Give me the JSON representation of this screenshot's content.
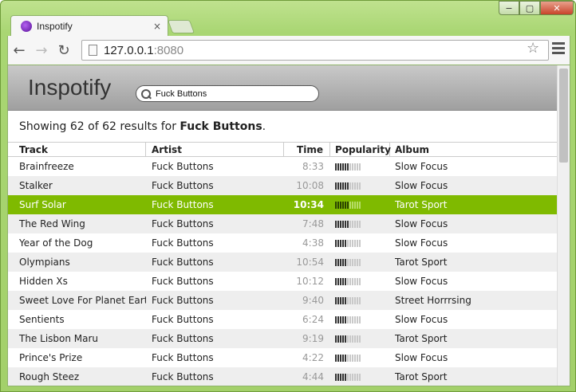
{
  "browser": {
    "tab_title": "Inspotify",
    "tab_close": "×",
    "url_host": "127.0.0.1",
    "url_port": ":8080",
    "back": "←",
    "forward": "→",
    "reload": "↻",
    "star": "☆",
    "min": "−",
    "max": "▢",
    "close": "✕"
  },
  "app": {
    "title": "Inspotify",
    "search_value": "Fuck Buttons"
  },
  "summary": {
    "prefix": "Showing 62 of 62 results for ",
    "query": "Fuck Buttons",
    "suffix": "."
  },
  "columns": {
    "track": "Track",
    "artist": "Artist",
    "time": "Time",
    "popularity": "Popularity",
    "album": "Album"
  },
  "rows": [
    {
      "track": "Brainfreeze",
      "artist": "Fuck Buttons",
      "time": "8:33",
      "pop": 6,
      "album": "Slow Focus"
    },
    {
      "track": "Stalker",
      "artist": "Fuck Buttons",
      "time": "10:08",
      "pop": 6,
      "album": "Slow Focus"
    },
    {
      "track": "Surf Solar",
      "artist": "Fuck Buttons",
      "time": "10:34",
      "pop": 6,
      "album": "Tarot Sport",
      "selected": true
    },
    {
      "track": "The Red Wing",
      "artist": "Fuck Buttons",
      "time": "7:48",
      "pop": 6,
      "album": "Slow Focus"
    },
    {
      "track": "Year of the Dog",
      "artist": "Fuck Buttons",
      "time": "4:38",
      "pop": 5,
      "album": "Slow Focus"
    },
    {
      "track": "Olympians",
      "artist": "Fuck Buttons",
      "time": "10:54",
      "pop": 5,
      "album": "Tarot Sport"
    },
    {
      "track": "Hidden Xs",
      "artist": "Fuck Buttons",
      "time": "10:12",
      "pop": 5,
      "album": "Slow Focus"
    },
    {
      "track": "Sweet Love For Planet Earth",
      "artist": "Fuck Buttons",
      "time": "9:40",
      "pop": 5,
      "album": "Street Horrrsing"
    },
    {
      "track": "Sentients",
      "artist": "Fuck Buttons",
      "time": "6:24",
      "pop": 5,
      "album": "Slow Focus"
    },
    {
      "track": "The Lisbon Maru",
      "artist": "Fuck Buttons",
      "time": "9:19",
      "pop": 5,
      "album": "Tarot Sport"
    },
    {
      "track": "Prince's Prize",
      "artist": "Fuck Buttons",
      "time": "4:22",
      "pop": 5,
      "album": "Slow Focus"
    },
    {
      "track": "Rough Steez",
      "artist": "Fuck Buttons",
      "time": "4:44",
      "pop": 5,
      "album": "Tarot Sport"
    }
  ],
  "popularity_max": 11
}
